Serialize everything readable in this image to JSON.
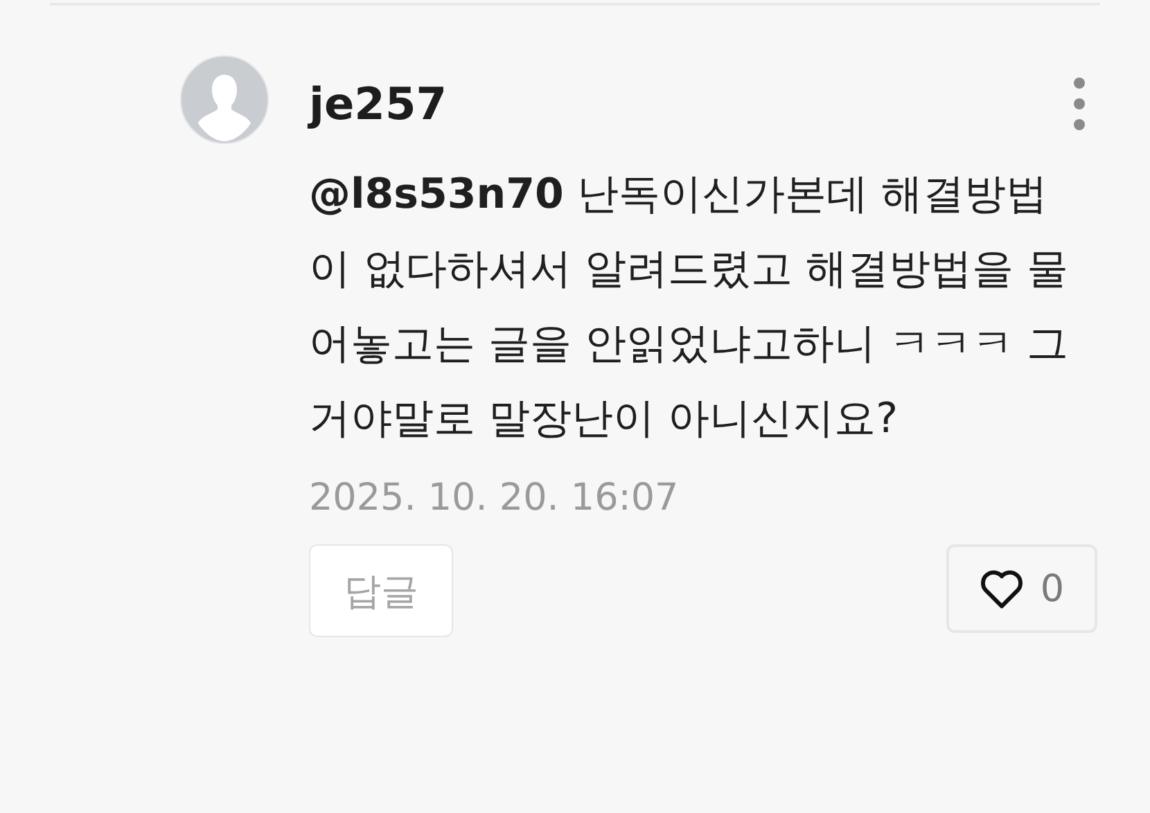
{
  "comment": {
    "author": "je257",
    "text": "**@l8s53n70** 난독이신가본데 해결방법이 없다하셔서 알려드렸고 해결방법을 물어놓고는 글을 안읽었냐고하니 ㅋㅋㅋ 그거야말로 말장난이 아니신지요?",
    "date": "2025. 10. 20. 16:07",
    "reply_label": "답글",
    "like_count": "0"
  }
}
